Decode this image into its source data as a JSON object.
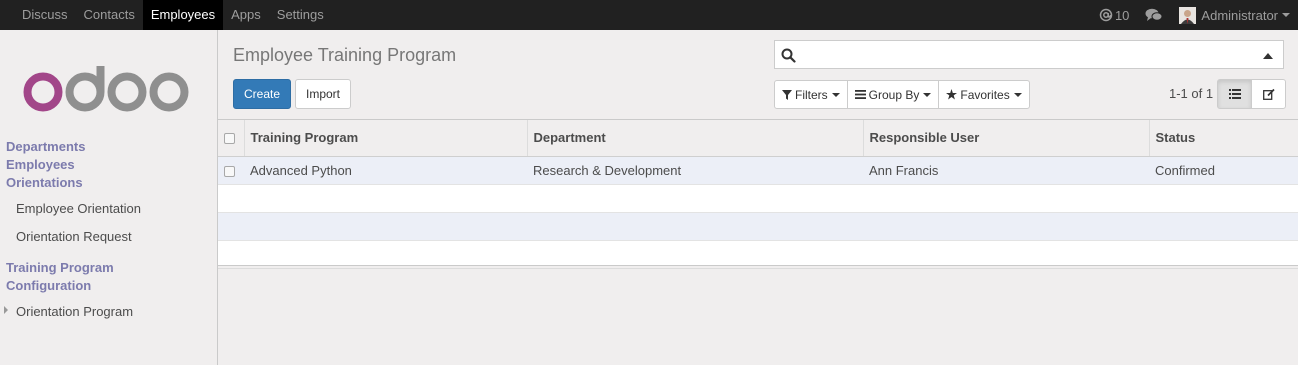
{
  "topbar": {
    "menu": [
      {
        "label": "Discuss"
      },
      {
        "label": "Contacts"
      },
      {
        "label": "Employees",
        "active": true
      },
      {
        "label": "Apps"
      },
      {
        "label": "Settings"
      }
    ],
    "mention_count": "10",
    "user_name": "Administrator"
  },
  "logo": {
    "text": "odoo"
  },
  "sidebar": {
    "departments": "Departments",
    "employees": "Employees",
    "orientations": "Orientations",
    "employee_orientation": "Employee Orientation",
    "orientation_request": "Orientation Request",
    "training_program": "Training Program",
    "configuration": "Configuration",
    "orientation_program": "Orientation Program"
  },
  "control_panel": {
    "title": "Employee Training Program",
    "create_label": "Create",
    "import_label": "Import",
    "filters_label": "Filters",
    "group_by_label": "Group By",
    "favorites_label": "Favorites",
    "pager": "1-1 of 1"
  },
  "table": {
    "columns": [
      "Training Program",
      "Department",
      "Responsible User",
      "Status"
    ],
    "rows": [
      [
        "Advanced Python",
        "Research & Development",
        "Ann Francis",
        "Confirmed"
      ]
    ]
  }
}
